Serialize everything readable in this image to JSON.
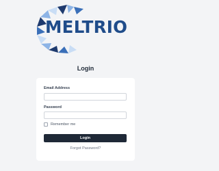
{
  "brand": {
    "name": "MELTRIO",
    "colors": {
      "text": "#1f4c8a",
      "dark_blue": "#1e3a6e",
      "mid_blue": "#3a6fb8",
      "light_blue": "#8db4e6",
      "pale_blue": "#c9ddf5"
    }
  },
  "page": {
    "title": "Login"
  },
  "form": {
    "email_label": "Email Address",
    "email_value": "",
    "email_placeholder": "",
    "password_label": "Password",
    "password_value": "",
    "password_placeholder": "",
    "remember_label": "Remember me",
    "remember_checked": false,
    "submit_label": "Login",
    "forgot_label": "Forgot Password?"
  },
  "colors": {
    "background": "#f3f4f6",
    "card": "#ffffff",
    "button": "#1f2937",
    "button_text": "#ffffff",
    "link": "#6b7280"
  }
}
